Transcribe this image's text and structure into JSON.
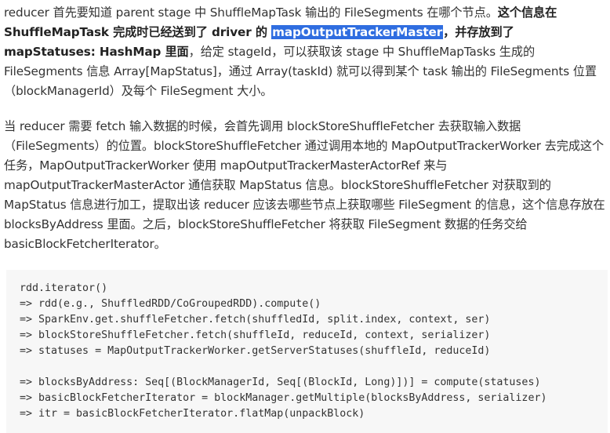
{
  "para1": {
    "t1": "reducer 首先要知道 parent stage 中 ShuffleMapTask 输出的 FileSegments 在哪个节点。",
    "b1": "这个信息在 ShuffleMapTask 完成时已经送到了 driver 的 ",
    "hl": "mapOutputTrackerMaster",
    "b2": "，并存放到了 mapStatuses: HashMap 里面",
    "t2": "，给定 stageId，可以获取该 stage 中 ShuffleMapTasks 生成的 FileSegments 信息 Array[MapStatus]，通过 Array(taskId) 就可以得到某个 task 输出的 FileSegments 位置（blockManagerId）及每个 FileSegment 大小。"
  },
  "para2": {
    "text": "当 reducer 需要 fetch 输入数据的时候，会首先调用 blockStoreShuffleFetcher 去获取输入数据（FileSegments）的位置。blockStoreShuffleFetcher 通过调用本地的 MapOutputTrackerWorker 去完成这个任务，MapOutputTrackerWorker 使用 mapOutputTrackerMasterActorRef 来与 mapOutputTrackerMasterActor 通信获取 MapStatus 信息。blockStoreShuffleFetcher 对获取到的 MapStatus 信息进行加工，提取出该 reducer 应该去哪些节点上获取哪些 FileSegment 的信息，这个信息存放在 blocksByAddress 里面。之后，blockStoreShuffleFetcher 将获取 FileSegment 数据的任务交给 basicBlockFetcherIterator。"
  },
  "code": {
    "lines": [
      "rdd.iterator()",
      "=> rdd(e.g., ShuffledRDD/CoGroupedRDD).compute()",
      "=> SparkEnv.get.shuffleFetcher.fetch(shuffledId, split.index, context, ser)",
      "=> blockStoreShuffleFetcher.fetch(shuffleId, reduceId, context, serializer)",
      "=> statuses = MapOutputTrackerWorker.getServerStatuses(shuffleId, reduceId)",
      "",
      "=> blocksByAddress: Seq[(BlockManagerId, Seq[(BlockId, Long)])] = compute(statuses)",
      "=> basicBlockFetcherIterator = blockManager.getMultiple(blocksByAddress, serializer)",
      "=> itr = basicBlockFetcherIterator.flatMap(unpackBlock)"
    ]
  },
  "colors": {
    "text": "#333333",
    "highlight_bg": "#2f6de0",
    "code_bg": "#f7f7f7"
  }
}
